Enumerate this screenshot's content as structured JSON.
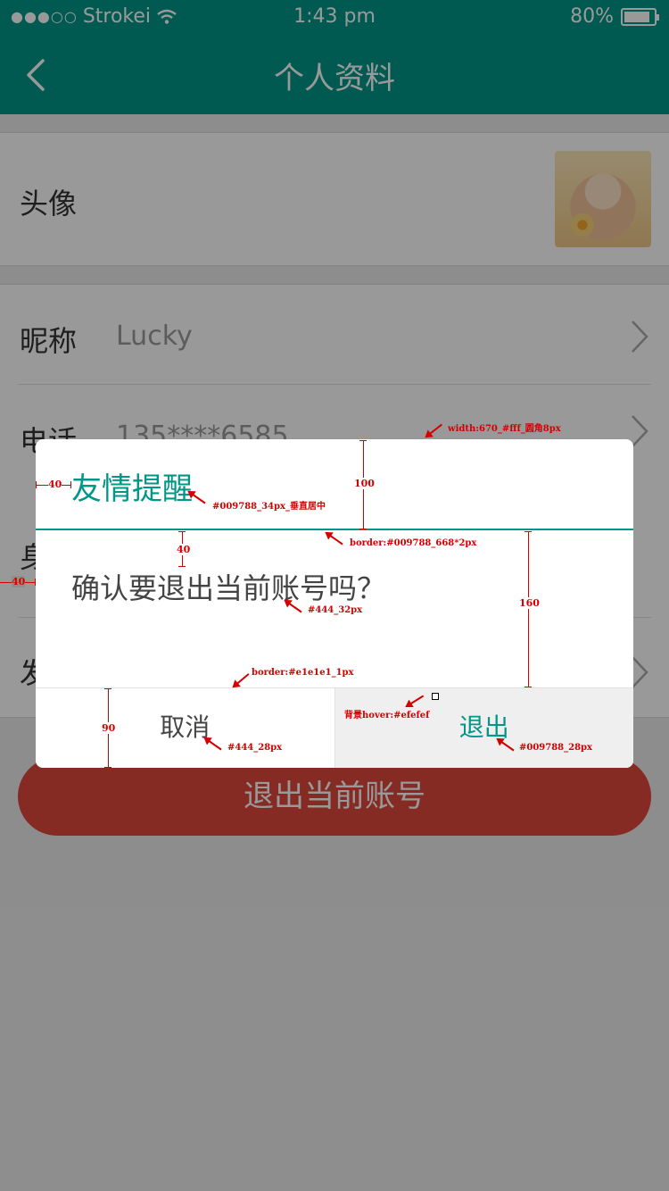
{
  "status_bar": {
    "signal": "●●●○○",
    "carrier": "Strokei",
    "time": "1:43 pm",
    "battery_percent": "80%"
  },
  "nav": {
    "title": "个人资料"
  },
  "profile": {
    "avatar_label": "头像",
    "nickname_label": "昵称",
    "nickname_value": "Lucky",
    "phone_label": "电话",
    "phone_value": "135****6585",
    "row3_label_partial": "身",
    "row4_label_partial": "发"
  },
  "logout_button": "退出当前账号",
  "dialog": {
    "title": "友情提醒",
    "message": "确认要退出当前账号吗？",
    "cancel": "取消",
    "confirm": "退出"
  },
  "annotations": {
    "width_note": "width:670_#fff_圆角8px",
    "title_note": "#009788_34px_垂直居中",
    "border_note": "border:#009788_668*2px",
    "msg_note": "#444_32px",
    "divider_note": "border:#e1e1e1_1px",
    "hover_note": "背景hover:#efefef",
    "cancel_note": "#444_28px",
    "confirm_note": "#009788_28px",
    "dim_40a": "40",
    "dim_40b": "40",
    "dim_40c": "40",
    "dim_100": "100",
    "dim_160": "160",
    "dim_90": "90"
  },
  "colors": {
    "primary": "#009788",
    "logout": "#e0473d",
    "text": "#444444",
    "divider": "#e1e1e1",
    "hover_bg": "#efefef",
    "annotation": "#d40000"
  }
}
